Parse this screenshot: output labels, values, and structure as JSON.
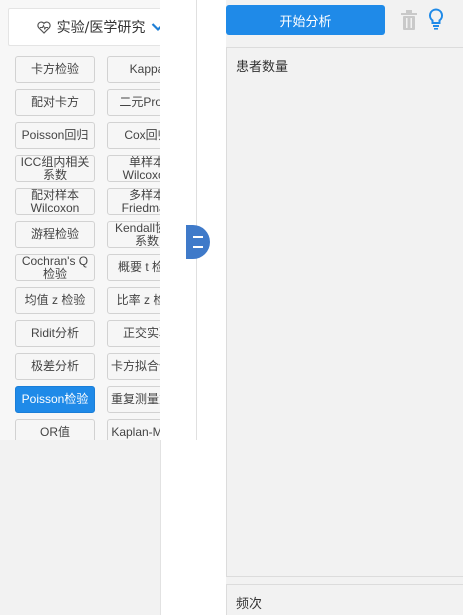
{
  "category": {
    "label": "实验/医学研究",
    "icon": "heart-pulse-icon",
    "chevron": "chevron-down-icon"
  },
  "methods": [
    {
      "label": "卡方检验"
    },
    {
      "label": "Kappa"
    },
    {
      "label": "配对卡方"
    },
    {
      "label": "二元Probit"
    },
    {
      "label": "Poisson回归"
    },
    {
      "label": "Cox回归"
    },
    {
      "label": "ICC组内相关系数"
    },
    {
      "label": "单样本Wilcoxon"
    },
    {
      "label": "配对样本Wilcoxon"
    },
    {
      "label": "多样本Friedman"
    },
    {
      "label": "游程检验"
    },
    {
      "label": "Kendall协调系数"
    },
    {
      "label": "Cochran's Q检验"
    },
    {
      "label": "概要 t 检验"
    },
    {
      "label": "均值 z 检验"
    },
    {
      "label": "比率 z 检验"
    },
    {
      "label": "Ridit分析"
    },
    {
      "label": "正交实验"
    },
    {
      "label": "极差分析"
    },
    {
      "label": "卡方拟合优度"
    },
    {
      "label": "Poisson检验",
      "active": true
    },
    {
      "label": "重复测量方差"
    },
    {
      "label": "OR值"
    },
    {
      "label": "Kaplan-Meier"
    }
  ],
  "toolbar": {
    "start_label": "开始分析",
    "accent": "#1f8ae8"
  },
  "fields": {
    "patients_label": "患者数量",
    "frequency_label": "频次"
  }
}
